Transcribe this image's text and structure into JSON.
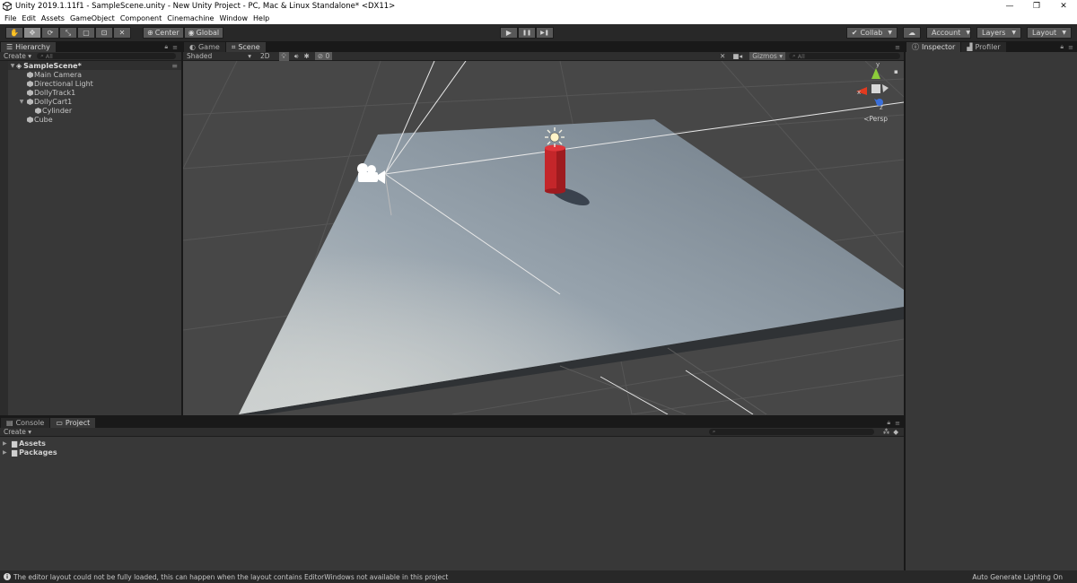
{
  "window": {
    "title": "Unity 2019.1.11f1 - SampleScene.unity - New Unity Project - PC, Mac & Linux Standalone* <DX11>",
    "controls": [
      "—",
      "❐",
      "✕"
    ]
  },
  "menu": [
    "File",
    "Edit",
    "Assets",
    "GameObject",
    "Component",
    "Cinemachine",
    "Window",
    "Help"
  ],
  "toolbar": {
    "tools": [
      {
        "icon": "hand-icon",
        "glyph": "✋"
      },
      {
        "icon": "move-icon",
        "glyph": "✥"
      },
      {
        "icon": "rotate-icon",
        "glyph": "⟳"
      },
      {
        "icon": "scale-icon",
        "glyph": "⤡"
      },
      {
        "icon": "rect-icon",
        "glyph": "▢"
      },
      {
        "icon": "transform-icon",
        "glyph": "⊡"
      },
      {
        "icon": "custom-tool-icon",
        "glyph": "✕"
      }
    ],
    "pivot": "Center",
    "space": "Global",
    "play": [
      "▶",
      "❚❚",
      "▶❚"
    ],
    "collab": "Collab",
    "cloud_glyph": "☁",
    "account": "Account",
    "layers": "Layers",
    "layout": "Layout"
  },
  "hierarchy": {
    "tab": "Hierarchy",
    "create": "Create",
    "search_placeholder": "All",
    "scene": "SampleScene*",
    "items": [
      {
        "label": "Main Camera",
        "depth": 1
      },
      {
        "label": "Directional Light",
        "depth": 1
      },
      {
        "label": "DollyTrack1",
        "depth": 1
      },
      {
        "label": "DollyCart1",
        "depth": 1,
        "expanded": true
      },
      {
        "label": "Cylinder",
        "depth": 2
      },
      {
        "label": "Cube",
        "depth": 1
      }
    ]
  },
  "scene_view": {
    "tabs": [
      "Game",
      "Scene"
    ],
    "active_tab": "Scene",
    "shading": "Shaded",
    "mode_2d": "2D",
    "fx_count": "0",
    "gizmos": "Gizmos",
    "search_placeholder": "All",
    "persp_label": "Persp",
    "gizmo_axes": [
      "y",
      "x",
      "z"
    ],
    "colors": {
      "background": "#474747",
      "plane": "#8d9aa5",
      "cylinder": "#c4262a"
    }
  },
  "inspector": {
    "tabs": [
      "Inspector",
      "Profiler"
    ],
    "active_tab": "Inspector"
  },
  "console_project": {
    "tabs": [
      "Console",
      "Project"
    ],
    "active_tab": "Project",
    "create": "Create",
    "folders": [
      "Assets",
      "Packages"
    ]
  },
  "status": {
    "message": "The editor layout could not be fully loaded, this can happen when the layout contains EditorWindows not available in this project",
    "right": "Auto Generate Lighting On"
  }
}
